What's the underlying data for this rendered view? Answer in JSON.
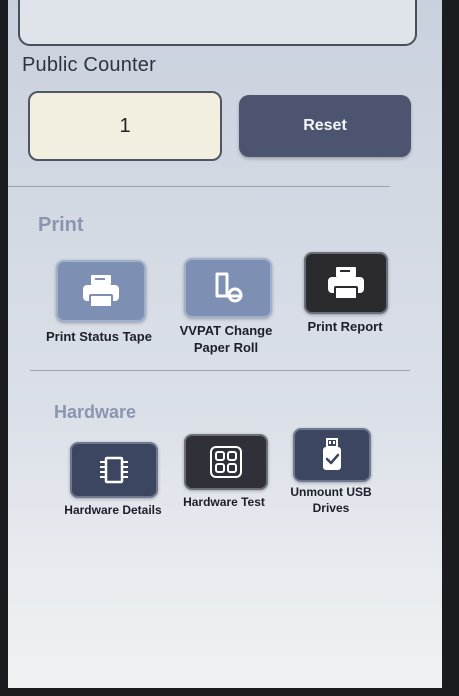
{
  "top_card": {},
  "counter": {
    "label": "Public Counter",
    "value": "1",
    "reset_label": "Reset"
  },
  "print": {
    "title": "Print",
    "items": [
      {
        "label": "Print Status Tape",
        "icon": "printer-icon"
      },
      {
        "label": "VVPAT Change Paper Roll",
        "icon": "paper-roll-icon"
      },
      {
        "label": "Print Report",
        "icon": "printer-icon"
      }
    ]
  },
  "hardware": {
    "title": "Hardware",
    "items": [
      {
        "label": "Hardware Details",
        "icon": "chip-icon"
      },
      {
        "label": "Hardware Test",
        "icon": "grid-icon"
      },
      {
        "label": "Unmount USB Drives",
        "icon": "usb-drive-icon"
      }
    ]
  },
  "colors": {
    "accent_button": "#4c5470",
    "tile_light": "#7d8fb3",
    "tile_dark": "#2b2a2c",
    "group_title": "#8a96b0"
  }
}
